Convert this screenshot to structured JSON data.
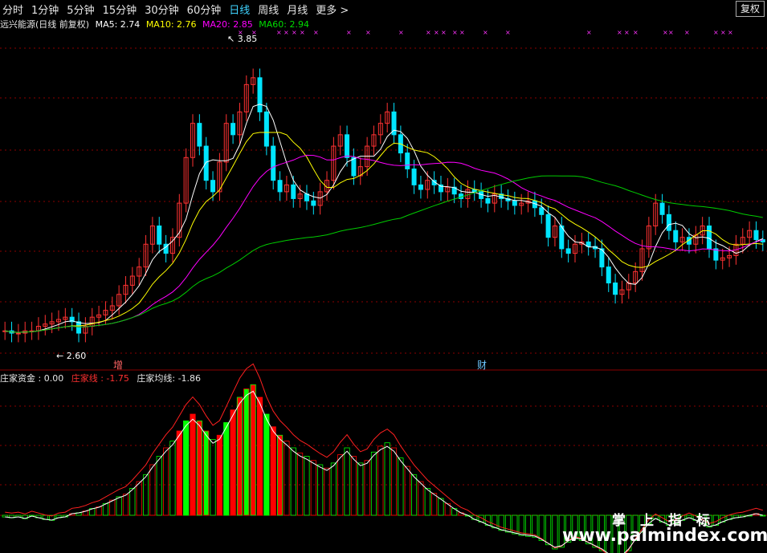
{
  "toolbar": {
    "tabs": [
      {
        "label": "分时",
        "active": false
      },
      {
        "label": "1分钟",
        "active": false
      },
      {
        "label": "5分钟",
        "active": false
      },
      {
        "label": "15分钟",
        "active": false
      },
      {
        "label": "30分钟",
        "active": false
      },
      {
        "label": "60分钟",
        "active": false
      },
      {
        "label": "日线",
        "active": true
      },
      {
        "label": "周线",
        "active": false
      },
      {
        "label": "月线",
        "active": false
      },
      {
        "label": "更多 >",
        "active": false
      }
    ],
    "fuquan_label": "复权"
  },
  "main_info": {
    "title": "远兴能源(日线 前复权)",
    "ma5": "MA5: 2.74",
    "ma10": "MA10: 2.76",
    "ma20": "MA20: 2.85",
    "ma60": "MA60: 2.94"
  },
  "price_annotations": {
    "high_label": "3.85",
    "low_label": "2.60",
    "marker1": "增",
    "marker2": "财"
  },
  "sub_info": {
    "zj": "庄家资金 : 0.00",
    "zjx": "庄家线 : -1.75",
    "zjjx": "庄家均线: -1.86"
  },
  "watermark": {
    "cn": "掌上指标",
    "url": "www.palmindex.com"
  },
  "colors": {
    "up": "#ff3232",
    "down": "#00e5ff",
    "ma5": "#ffffff",
    "ma10": "#ffff00",
    "ma20": "#ff00ff",
    "ma60": "#00cc00",
    "grid": "#8b0000",
    "bar_green": "#00ff00",
    "bar_red": "#ff0000"
  },
  "chart_data": {
    "type": "candlestick",
    "ylim": [
      2.5,
      3.95
    ],
    "closes": [
      2.64,
      2.63,
      2.63,
      2.64,
      2.64,
      2.66,
      2.67,
      2.68,
      2.69,
      2.7,
      2.68,
      2.63,
      2.66,
      2.7,
      2.71,
      2.73,
      2.75,
      2.8,
      2.84,
      2.88,
      2.92,
      3.02,
      3.1,
      3.02,
      2.98,
      3.05,
      3.2,
      3.4,
      3.55,
      3.45,
      3.3,
      3.25,
      3.38,
      3.55,
      3.5,
      3.6,
      3.72,
      3.75,
      3.6,
      3.45,
      3.3,
      3.25,
      3.28,
      3.22,
      3.24,
      3.21,
      3.19,
      3.25,
      3.3,
      3.45,
      3.5,
      3.4,
      3.32,
      3.36,
      3.45,
      3.5,
      3.55,
      3.6,
      3.5,
      3.42,
      3.35,
      3.28,
      3.26,
      3.3,
      3.28,
      3.25,
      3.27,
      3.24,
      3.22,
      3.26,
      3.25,
      3.22,
      3.2,
      3.24,
      3.22,
      3.21,
      3.19,
      3.2,
      3.21,
      3.18,
      3.15,
      3.05,
      3.1,
      3.0,
      2.98,
      3.02,
      3.03,
      3.01,
      3.0,
      2.92,
      2.85,
      2.8,
      2.82,
      2.85,
      2.9,
      3.0,
      3.1,
      3.2,
      3.15,
      3.08,
      3.03,
      3.05,
      3.02,
      3.06,
      3.1,
      3.0,
      2.95,
      2.96,
      2.97,
      3.02,
      3.05,
      3.08,
      3.04,
      3.03
    ],
    "volumes_zj": [
      -2,
      -3,
      -2,
      -4,
      -1,
      -3,
      -5,
      -6,
      -3,
      -2,
      2,
      3,
      5,
      8,
      10,
      14,
      18,
      22,
      25,
      32,
      40,
      48,
      60,
      70,
      80,
      88,
      100,
      112,
      120,
      112,
      100,
      90,
      95,
      110,
      125,
      140,
      150,
      155,
      140,
      120,
      105,
      95,
      88,
      80,
      74,
      70,
      65,
      60,
      56,
      62,
      72,
      80,
      70,
      62,
      65,
      75,
      82,
      86,
      80,
      68,
      58,
      48,
      40,
      32,
      26,
      20,
      14,
      8,
      3,
      0,
      -5,
      -8,
      -12,
      -15,
      -18,
      -20,
      -22,
      -24,
      -25,
      -26,
      -30,
      -35,
      -40,
      -38,
      -32,
      -28,
      -30,
      -34,
      -38,
      -42,
      -48,
      -55,
      -50,
      -42,
      -30,
      -20,
      -10,
      -4,
      -8,
      -12,
      -10,
      -6,
      -3,
      -6,
      -10,
      -14,
      -12,
      -8,
      -5,
      -3,
      -2,
      0,
      2,
      0
    ],
    "annotations": [
      "3.85",
      "2.60",
      "增",
      "财"
    ]
  }
}
